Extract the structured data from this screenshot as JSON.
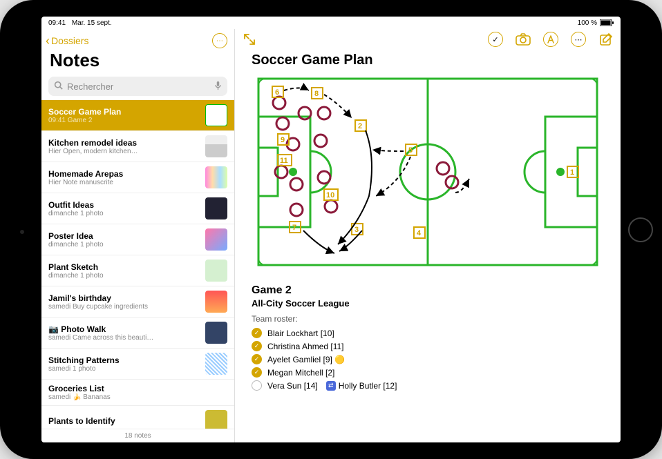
{
  "status": {
    "time": "09:41",
    "date": "Mar. 15 sept.",
    "battery": "100 %"
  },
  "sidebar": {
    "back_label": "Dossiers",
    "title": "Notes",
    "search_placeholder": "Rechercher",
    "footer": "18 notes",
    "notes": [
      {
        "title": "Soccer Game Plan",
        "time": "09:41",
        "preview": "Game 2",
        "thumb": "field",
        "selected": true
      },
      {
        "title": "Kitchen remodel ideas",
        "time": "Hier",
        "preview": "Open, modern kitchen…",
        "thumb": "kitchen"
      },
      {
        "title": "Homemade Arepas",
        "time": "Hier",
        "preview": "Note manuscrite",
        "thumb": "recipe"
      },
      {
        "title": "Outfit Ideas",
        "time": "dimanche",
        "preview": "1 photo",
        "thumb": "outfit"
      },
      {
        "title": "Poster Idea",
        "time": "dimanche",
        "preview": "1 photo",
        "thumb": "poster"
      },
      {
        "title": "Plant Sketch",
        "time": "dimanche",
        "preview": "1 photo",
        "thumb": "plant"
      },
      {
        "title": "Jamil's birthday",
        "time": "samedi",
        "preview": "Buy cupcake ingredients",
        "thumb": "birthday"
      },
      {
        "title": "📷 Photo Walk",
        "time": "samedi",
        "preview": "Came across this beauti…",
        "thumb": "photowalk"
      },
      {
        "title": "Stitching Patterns",
        "time": "samedi",
        "preview": "1 photo",
        "thumb": "stitch"
      },
      {
        "title": "Groceries List",
        "time": "samedi",
        "preview": "🍌 Bananas",
        "thumb": ""
      },
      {
        "title": "Plants to Identify",
        "time": "",
        "preview": "",
        "thumb": "plants"
      }
    ]
  },
  "note": {
    "title": "Soccer Game Plan",
    "gameHeading": "Game 2",
    "leagueHeading": "All-City Soccer League",
    "rosterLabel": "Team roster:",
    "roster": [
      {
        "name": "Blair Lockhart [10]",
        "checked": true
      },
      {
        "name": "Christina Ahmed [11]",
        "checked": true
      },
      {
        "name": "Ayelet Gamliel [9] 🟡",
        "checked": true
      },
      {
        "name": "Megan Mitchell [2]",
        "checked": true
      },
      {
        "name": "Vera Sun [14]",
        "checked": false,
        "swap": "Holly Butler [12]"
      }
    ]
  },
  "colors": {
    "accent": "#D4A500"
  }
}
